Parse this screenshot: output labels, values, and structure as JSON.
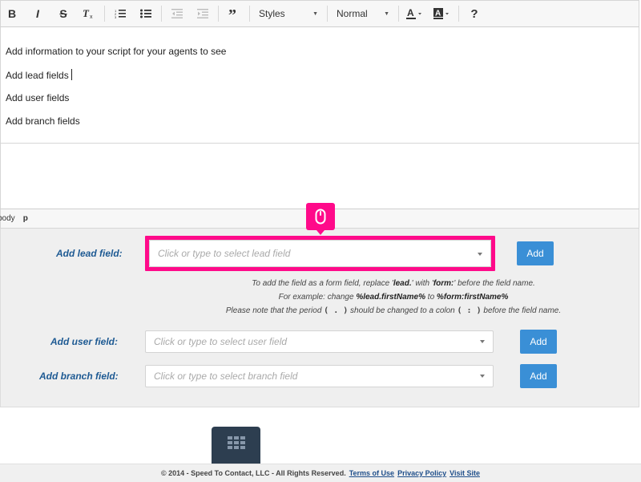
{
  "toolbar": {
    "bold_label": "B",
    "italic_label": "I",
    "strike_label": "S",
    "clear_format_label": "Tx",
    "blockquote_label": "99",
    "styles_label": "Styles",
    "format_label": "Normal",
    "help_label": "?"
  },
  "editor": {
    "lines": [
      "Add information to your script for your agents to see",
      "Add lead fields",
      "Add user fields",
      "Add branch fields"
    ]
  },
  "pathbar": {
    "items": [
      "body",
      "p"
    ]
  },
  "fields": {
    "lead": {
      "label": "Add lead field:",
      "placeholder": "Click or type to select lead field",
      "button": "Add"
    },
    "user": {
      "label": "Add user field:",
      "placeholder": "Click or type to select user field",
      "button": "Add"
    },
    "branch": {
      "label": "Add branch field:",
      "placeholder": "Click or type to select branch field",
      "button": "Add"
    }
  },
  "help": {
    "line1_a": "To add the field as a form field, replace '",
    "line1_b": "lead.",
    "line1_c": "' with '",
    "line1_d": "form:",
    "line1_e": "' before the field name.",
    "line2_a": "For example: change ",
    "line2_b": "%lead.firstName%",
    "line2_c": " to ",
    "line2_d": "%form:firstName%",
    "line3_a": "Please note that the period ",
    "line3_b": "( . )",
    "line3_c": " should be changed to a colon ",
    "line3_d": "( : )",
    "line3_e": " before the field name."
  },
  "footer": {
    "copyright": "© 2014 - Speed To Contact, LLC - All Rights Reserved.",
    "terms": "Terms of Use",
    "privacy": "Privacy Policy",
    "visit": "Visit Site"
  },
  "colors": {
    "accent": "#ff0a8a",
    "button": "#3a8fd6",
    "label": "#1e5a93",
    "grid_tab": "#2d3e50"
  }
}
